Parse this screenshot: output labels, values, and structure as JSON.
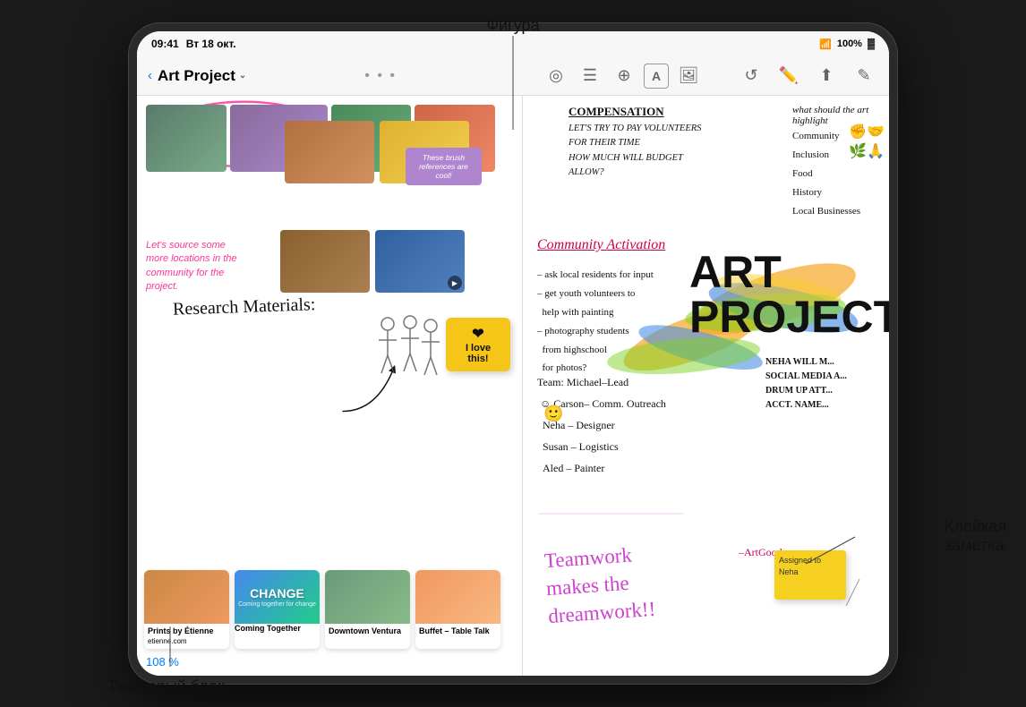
{
  "status_bar": {
    "time": "09:41",
    "date": "Вт 18 окт.",
    "wifi": "WiFi",
    "battery": "100%",
    "battery_icon": "🔋"
  },
  "toolbar": {
    "back_label": "‹",
    "project_title": "Art Project",
    "chevron": "⌄",
    "dots": "• • •",
    "icons": {
      "route": "◎",
      "list": "☰",
      "layers": "⊕",
      "text": "A",
      "image": "⊞",
      "undo": "↺",
      "pen": "✏",
      "share": "↑",
      "edit": "✎"
    }
  },
  "canvas": {
    "zoom": "108 %",
    "sticky_brush": "These brush references are cool!",
    "sticky_heart": {
      "emoji": "❤",
      "text": "I love\nthis!"
    },
    "sticky_neha": "Assigned to\nNeha",
    "pink_annotation": "Let's source some more locations in the community for the project.",
    "research_materials": "Research Materials:",
    "compensation": {
      "title": "COMPENSATION",
      "body": "LET'S TRY TO PAY VOLUNTEERS FOR THEIR TIME\nHOW MUCH WILL BUDGET ALLOW?"
    },
    "community_activation": "Community Activation",
    "community_list": "– ask local residents for input\n– get youth volunteers to\n  help with painting\n– photography students\n  from highschool\n  for photos?",
    "team": "Team: Michael–Lead\n  Carson– Comm. Outreach\n  Neha – Designer\n  Susan – Logistics\n  Aled – Painter",
    "art_project": "ART\nPROJECT",
    "teamwork": "Teamwork\nmakes the\ndreamwork!!",
    "right_column_title": "what should the art highlight",
    "right_column_list": "Community\nInclusion\nFood\nHistory\nLocal Businesses",
    "neha_note": "NEHA WILL M...\nSOCIAL MEDIA A...\nDRUM UP ATT...\nACCT. NAME...",
    "auth_note": "–ArtGood..."
  },
  "cards": {
    "prints": {
      "title": "Prints by Étienne",
      "subtitle": "etienne.com"
    },
    "change": {
      "title": "Coming Together",
      "subtitle": "Coming together for change"
    },
    "ventura": {
      "title": "Downtown Ventura",
      "subtitle": ""
    },
    "buffet": {
      "title": "Buffet – Table Talk",
      "subtitle": ""
    }
  },
  "annotations": {
    "figura_label": "Фигура",
    "text_block_label": "Текстовый блок",
    "sticky_label": "Клейкая\nзаметка"
  }
}
